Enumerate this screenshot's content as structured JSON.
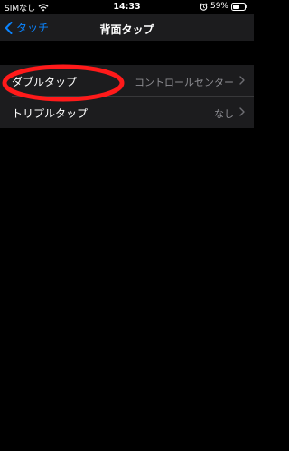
{
  "status_bar": {
    "carrier": "SIMなし",
    "time": "14:33",
    "battery": "59%"
  },
  "nav": {
    "back_label": "タッチ",
    "title": "背面タップ"
  },
  "rows": [
    {
      "label": "ダブルタップ",
      "value": "コントロールセンター"
    },
    {
      "label": "トリプルタップ",
      "value": "なし"
    }
  ],
  "colors": {
    "accent": "#0a84ff",
    "annotation": "#ff1a1a",
    "background": "#000000",
    "cell": "#1c1c1e",
    "secondary_text": "#8e8e93"
  },
  "icons": [
    "wifi-icon",
    "alarm-icon",
    "battery-icon",
    "chevron-left-icon",
    "chevron-right-icon"
  ]
}
